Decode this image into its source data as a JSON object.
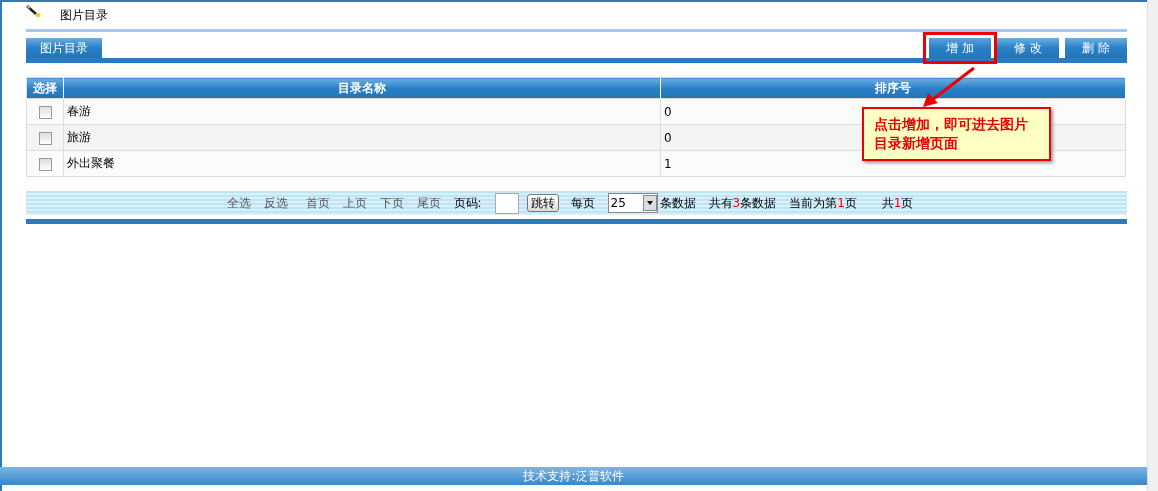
{
  "page_title": "图片目录",
  "tabs": [
    {
      "label": "图片目录",
      "selected": true
    }
  ],
  "actions": [
    {
      "label": "增 加",
      "highlighted": true
    },
    {
      "label": "修 改",
      "highlighted": false
    },
    {
      "label": "删 除",
      "highlighted": false
    }
  ],
  "table": {
    "columns": [
      "选择",
      "目录名称",
      "排序号"
    ],
    "rows": [
      {
        "checked": false,
        "name": "春游",
        "order": "0"
      },
      {
        "checked": false,
        "name": "旅游",
        "order": "0"
      },
      {
        "checked": false,
        "name": "外出聚餐",
        "order": "1"
      }
    ]
  },
  "pager": {
    "links": [
      "全选",
      "反选",
      "首页",
      "上页",
      "下页",
      "尾页"
    ],
    "page_label": "页码:",
    "go": "跳转",
    "per_page_label": "每页",
    "per_page": "25",
    "per_page_suffix": "条数据",
    "total": {
      "before": "共有",
      "count": "3",
      "after": "条数据"
    },
    "current": {
      "before": "当前为第",
      "count": "1",
      "after": "页"
    },
    "pages": {
      "before": "共",
      "count": "1",
      "after": "页"
    }
  },
  "callout": "点击增加，即可进去图片目录新增页面",
  "footer": "技术支持:泛普软件"
}
